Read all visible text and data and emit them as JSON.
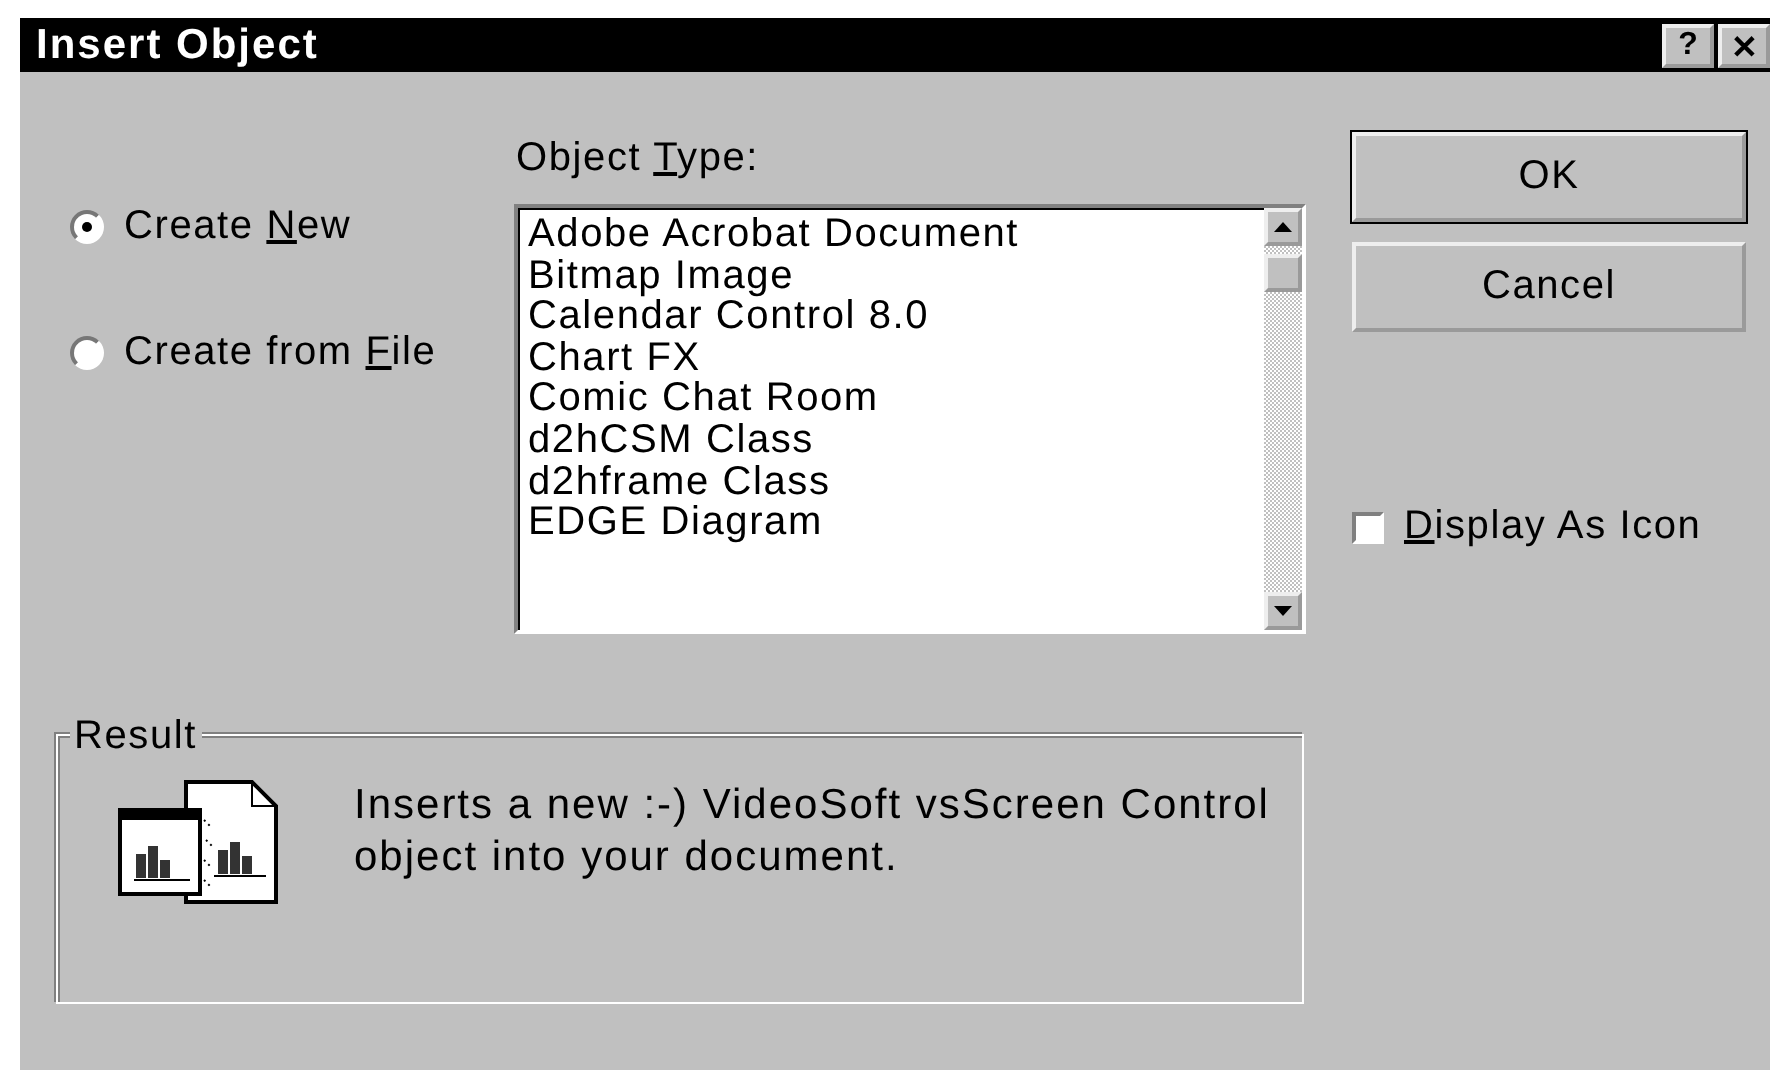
{
  "window": {
    "title": "Insert Object",
    "title_buttons": [
      {
        "label": "?"
      },
      {
        "label": "✕"
      }
    ]
  },
  "options": [
    {
      "before": "Create ",
      "key": "N",
      "after": "ew",
      "selected": true
    },
    {
      "before": "Create from ",
      "key": "F",
      "after": "ile",
      "selected": false
    }
  ],
  "object_type": {
    "label": {
      "before": "Object ",
      "key": "T",
      "after": "ype:"
    },
    "items": [
      {
        "label": "Adobe Acrobat Document",
        "selected": false
      },
      {
        "label": "Bitmap Image",
        "selected": false
      },
      {
        "label": "Calendar Control 8.0",
        "selected": false
      },
      {
        "label": "Chart FX",
        "selected": false
      },
      {
        "label": "Comic Chat Room",
        "selected": false
      },
      {
        "label": "d2hCSM Class",
        "selected": false
      },
      {
        "label": "d2hframe Class",
        "selected": false
      },
      {
        "label": "EDGE Diagram",
        "selected": false
      }
    ]
  },
  "buttons": [
    {
      "label": "OK",
      "default": true
    },
    {
      "label": "Cancel",
      "default": false
    }
  ],
  "display_as_icon": {
    "key": "D",
    "after": "isplay As Icon",
    "checked": false
  },
  "result": {
    "title": "Result",
    "text": "Inserts a new :-) VideoSoft vsScreen Control object into your document."
  }
}
